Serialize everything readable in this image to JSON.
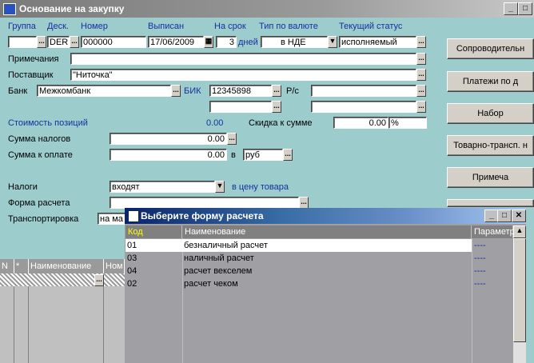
{
  "window": {
    "title": "Основание на закупку"
  },
  "labels": {
    "group": "Группа",
    "desk": "Деск.",
    "number": "Номер",
    "issued": "Выписан",
    "term": "На срок",
    "currency_type": "Тип по валюте",
    "status": "Текущий статус",
    "notes": "Примечания",
    "supplier": "Поставщик",
    "bank": "Банк",
    "bik": "БИК",
    "rs": "Р/с",
    "cost": "Стоимость позиций",
    "discount": "Скидка к сумме",
    "tax_sum": "Сумма налогов",
    "pay_sum": "Сумма к оплате",
    "in": "в",
    "taxes": "Налоги",
    "in_price": "в цену товара",
    "pay_form": "Форма расчета",
    "transport": "Транспортировка",
    "days": "дней"
  },
  "values": {
    "group": "",
    "desk": "DER",
    "number": "000000",
    "issued": "17/06/2009",
    "term": "3",
    "currency_type": "в НДЕ",
    "status": "исполняемый",
    "notes": "",
    "supplier": "\"Ниточка\"",
    "bank": "Межкомбанк",
    "bik": "12345898",
    "rs1": "",
    "rs2": "",
    "cost": "0.00",
    "discount": "0.00",
    "discount_unit": "%",
    "tax_sum": "0.00",
    "pay_sum": "0.00",
    "currency": "руб",
    "taxes": "входят",
    "pay_form": "",
    "transport": "на ма"
  },
  "buttons": {
    "accompanying": "Сопроводительн",
    "payments": "Платежи по д",
    "set": "Набор",
    "waybill": "Товарно-трансп. н",
    "note": "Примеча",
    "dots": "..."
  },
  "grid": {
    "columns": [
      "N",
      "*",
      "Наименование",
      "Ном"
    ]
  },
  "dialog": {
    "title": "Выберите форму расчета",
    "columns": [
      "Код",
      "Наименование",
      "Параметр"
    ],
    "rows": [
      {
        "code": "01",
        "name": "безналичный расчет",
        "param": "----"
      },
      {
        "code": "03",
        "name": "наличный расчет",
        "param": "----"
      },
      {
        "code": "04",
        "name": "расчет векселем",
        "param": "----"
      },
      {
        "code": "02",
        "name": "расчет чеком",
        "param": "----"
      }
    ],
    "controls": {
      "minimize": "_",
      "maximize": "□",
      "close": "✕"
    }
  },
  "window_controls": {
    "minimize": "_",
    "maximize": "□"
  }
}
